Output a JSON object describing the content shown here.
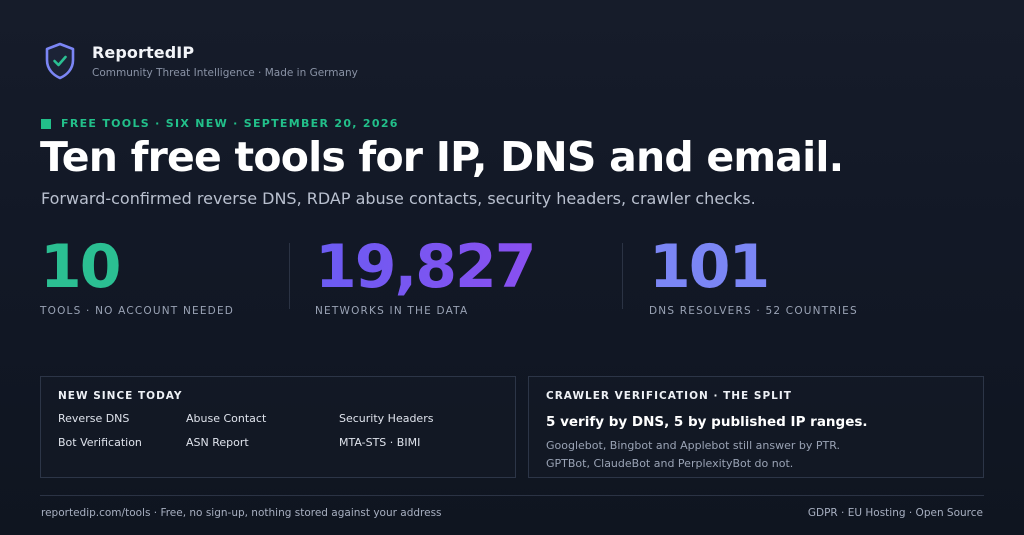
{
  "brand": {
    "name": "ReportedIP",
    "tagline": "Community Threat Intelligence · Made in Germany",
    "logo_icon": "shield-check-icon",
    "accent": "#7b86f5"
  },
  "kicker": "FREE TOOLS · SIX NEW · SEPTEMBER 20, 2026",
  "headline": "Ten free tools for IP, DNS and email.",
  "subline": "Forward-confirmed reverse DNS, RDAP abuse contacts, security headers, crawler checks.",
  "stats": [
    {
      "value": "10",
      "label": "TOOLS · NO ACCOUNT NEEDED",
      "color": "#2bbf92"
    },
    {
      "value": "19,827",
      "label": "NETWORKS IN THE DATA",
      "color": "#7a55f1"
    },
    {
      "value": "101",
      "label": "DNS RESOLVERS · 52 COUNTRIES",
      "color": "#7b86f5"
    }
  ],
  "new_tools": {
    "title": "NEW SINCE TODAY",
    "items": [
      "Reverse DNS",
      "Abuse Contact",
      "Security Headers",
      "Bot Verification",
      "ASN Report",
      "MTA-STS · BIMI"
    ]
  },
  "crawler": {
    "title": "CRAWLER VERIFICATION · THE SPLIT",
    "headline": "5 verify by DNS, 5 by published IP ranges.",
    "line1": "Googlebot, Bingbot and Applebot still answer by PTR.",
    "line2": "GPTBot, ClaudeBot and PerplexityBot do not."
  },
  "footer": {
    "left": "reportedip.com/tools · Free, no sign-up, nothing stored against your address",
    "right": "GDPR · EU Hosting · Open Source"
  }
}
